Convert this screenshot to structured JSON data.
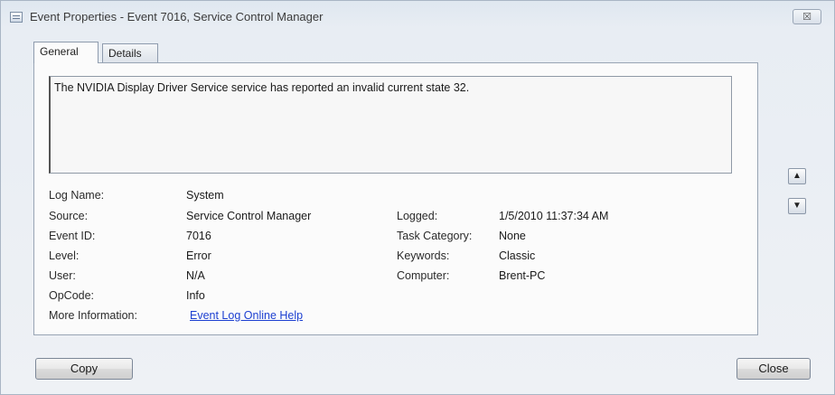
{
  "window": {
    "title": "Event Properties - Event 7016, Service Control Manager",
    "close_glyph": "☒"
  },
  "tabs": [
    {
      "label": "General",
      "active": true
    },
    {
      "label": "Details",
      "active": false
    }
  ],
  "event": {
    "description": "The NVIDIA Display Driver Service service has reported an invalid current state 32.",
    "log_name_label": "Log Name:",
    "log_name": "System",
    "source_label": "Source:",
    "source": "Service Control Manager",
    "logged_label": "Logged:",
    "logged": "1/5/2010 11:37:34 AM",
    "event_id_label": "Event ID:",
    "event_id": "7016",
    "task_category_label": "Task Category:",
    "task_category": "None",
    "level_label": "Level:",
    "level": "Error",
    "keywords_label": "Keywords:",
    "keywords": "Classic",
    "user_label": "User:",
    "user": "N/A",
    "computer_label": "Computer:",
    "computer": "Brent-PC",
    "opcode_label": "OpCode:",
    "opcode": "Info",
    "more_info_label": "More Information:",
    "more_info_link": "Event Log Online Help"
  },
  "nav": {
    "up_icon": "arrow-up-icon",
    "down_icon": "arrow-down-icon"
  },
  "buttons": {
    "copy": "Copy",
    "close": "Close"
  }
}
